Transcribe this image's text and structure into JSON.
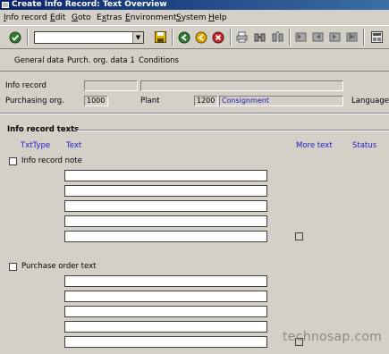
{
  "window": {
    "title": "Create Info Record: Text Overview"
  },
  "menu": [
    "Info record",
    "Edit",
    "Goto",
    "Extras",
    "Environment",
    "System",
    "Help"
  ],
  "menu_mnemonics": [
    "I",
    "E",
    "G",
    "x",
    "E",
    "S",
    "H"
  ],
  "toolbar": {
    "command_field_value": "",
    "icons": [
      "enter-icon",
      "save-icon",
      "back-icon",
      "exit-icon",
      "cancel-icon",
      "print-icon",
      "find-icon",
      "find-next-icon",
      "first-page-icon",
      "previous-page-icon",
      "next-page-icon",
      "last-page-icon",
      "layout-icon"
    ]
  },
  "app_toolbar": {
    "buttons": [
      "General data",
      "Purch. org. data 1",
      "Conditions"
    ]
  },
  "header": {
    "info_record_label": "Info record",
    "info_record_value": "",
    "info_record_desc": "",
    "purch_org_label": "Purchasing org.",
    "purch_org_value": "1000",
    "plant_label": "Plant",
    "plant_value": "1200",
    "plant_desc": "Consignment",
    "language_label": "Language"
  },
  "texts_section": {
    "title": "Info record texts",
    "col_txttype": "TxtType",
    "col_text": "Text",
    "col_more_text": "More text",
    "col_status": "Status",
    "groups": [
      {
        "name": "Info record note",
        "checked": false,
        "lines": [
          "",
          "",
          "",
          "",
          ""
        ]
      },
      {
        "name": "Purchase order text",
        "checked": false,
        "lines": [
          "",
          "",
          "",
          "",
          ""
        ]
      }
    ]
  },
  "watermark": "technosap.com",
  "colors": {
    "title_bar": "#0a246a",
    "background": "#d4d0c8",
    "column_header": "#2020c8"
  }
}
